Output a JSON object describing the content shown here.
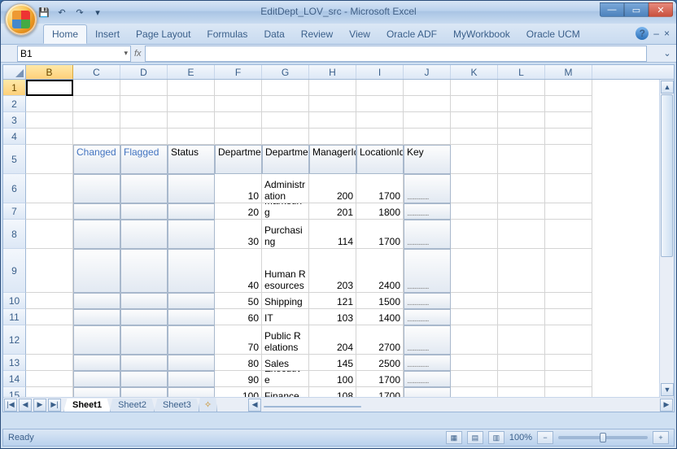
{
  "title": "EditDept_LOV_src - Microsoft Excel",
  "qat": {
    "save": "💾",
    "undo": "↶",
    "redo": "↷",
    "more": "▾"
  },
  "win": {
    "min": "—",
    "max": "▭",
    "close": "✕"
  },
  "ribbon": {
    "tabs": [
      "Home",
      "Insert",
      "Page Layout",
      "Formulas",
      "Data",
      "Review",
      "View",
      "Oracle ADF",
      "MyWorkbook",
      "Oracle UCM"
    ],
    "help": "?",
    "ribmin": "–",
    "ribclose": "×"
  },
  "namebox": {
    "value": "B1",
    "dd": "▾"
  },
  "fx": {
    "label": "fx"
  },
  "columns": [
    "B",
    "C",
    "D",
    "E",
    "F",
    "G",
    "H",
    "I",
    "J",
    "K",
    "L",
    "M"
  ],
  "active_column_index": 0,
  "rows": [
    "1",
    "2",
    "3",
    "4",
    "5",
    "6",
    "7",
    "8",
    "9",
    "10",
    "11",
    "12",
    "13",
    "14",
    "15"
  ],
  "active_row_index": 0,
  "table": {
    "headers": {
      "changed": "Changed",
      "flagged": "Flagged",
      "status": "Status",
      "dept_id": "DepartmentId",
      "dept_name": "DepartmentName",
      "manager_id": "ManagerId",
      "location_id": "LocationId",
      "key": "Key"
    },
    "rows": [
      {
        "dept_id": "10",
        "dept_name": "Administration",
        "manager_id": "200",
        "location_id": "1700"
      },
      {
        "dept_id": "20",
        "dept_name": "Marketing",
        "manager_id": "201",
        "location_id": "1800"
      },
      {
        "dept_id": "30",
        "dept_name": "Purchasing",
        "manager_id": "114",
        "location_id": "1700"
      },
      {
        "dept_id": "40",
        "dept_name": "Human Resources",
        "manager_id": "203",
        "location_id": "2400"
      },
      {
        "dept_id": "50",
        "dept_name": "Shipping",
        "manager_id": "121",
        "location_id": "1500"
      },
      {
        "dept_id": "60",
        "dept_name": "IT",
        "manager_id": "103",
        "location_id": "1400"
      },
      {
        "dept_id": "70",
        "dept_name": "Public Relations",
        "manager_id": "204",
        "location_id": "2700"
      },
      {
        "dept_id": "80",
        "dept_name": "Sales",
        "manager_id": "145",
        "location_id": "2500"
      },
      {
        "dept_id": "90",
        "dept_name": "Executive",
        "manager_id": "100",
        "location_id": "1700"
      },
      {
        "dept_id": "100",
        "dept_name": "Finance",
        "manager_id": "108",
        "location_id": "1700"
      }
    ],
    "key_placeholder": "..............."
  },
  "sheets": {
    "tabs": [
      "Sheet1",
      "Sheet2",
      "Sheet3"
    ],
    "active": 0,
    "new": "✧"
  },
  "nav": {
    "first": "|◀",
    "prev": "◀",
    "next": "▶",
    "last": "▶|",
    "up": "▲",
    "down": "▼",
    "left": "◀",
    "right": "▶"
  },
  "status": {
    "ready": "Ready",
    "zoom": "100%",
    "minus": "−",
    "plus": "+"
  },
  "views": {
    "normal": "▦",
    "layout": "▤",
    "break": "▥"
  }
}
